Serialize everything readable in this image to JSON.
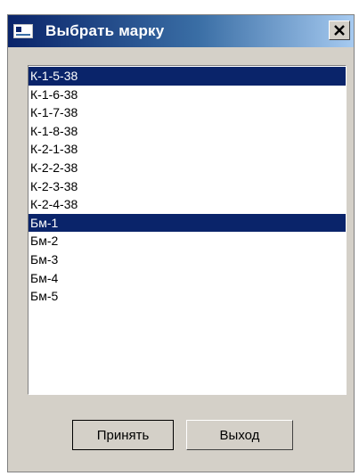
{
  "window": {
    "title": "Выбрать марку",
    "close_glyph": "✕"
  },
  "list": {
    "items": [
      {
        "label": "К-1-5-38",
        "selected": true
      },
      {
        "label": "К-1-6-38",
        "selected": false
      },
      {
        "label": "К-1-7-38",
        "selected": false
      },
      {
        "label": "К-1-8-38",
        "selected": false
      },
      {
        "label": "К-2-1-38",
        "selected": false
      },
      {
        "label": "К-2-2-38",
        "selected": false
      },
      {
        "label": "К-2-3-38",
        "selected": false
      },
      {
        "label": "К-2-4-38",
        "selected": false
      },
      {
        "label": "Бм-1",
        "selected": true
      },
      {
        "label": "Бм-2",
        "selected": false
      },
      {
        "label": "Бм-3",
        "selected": false
      },
      {
        "label": "Бм-4",
        "selected": false
      },
      {
        "label": "Бм-5",
        "selected": false
      }
    ]
  },
  "buttons": {
    "accept_label": "Принять",
    "exit_label": "Выход"
  },
  "colors": {
    "selection": "#0a246a",
    "dialog_face": "#d4d0c8"
  }
}
